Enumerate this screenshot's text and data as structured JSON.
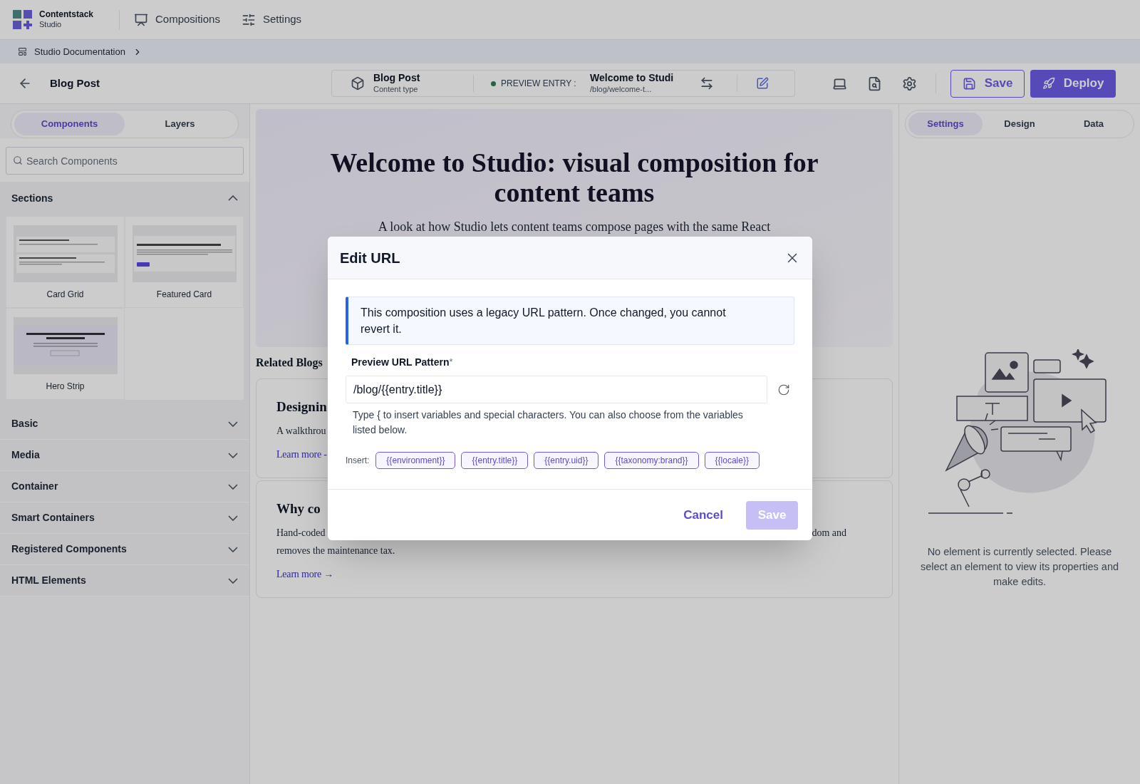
{
  "top_nav": {
    "brand": {
      "name": "Contentstack",
      "subtitle": "Studio"
    },
    "items": [
      {
        "label": "Compositions",
        "kind": "compositions"
      },
      {
        "label": "Settings",
        "kind": "settings"
      }
    ]
  },
  "breadcrumb": {
    "label": "Studio Documentation"
  },
  "toolbar": {
    "title": "Blog Post",
    "content_type": {
      "name": "Blog Post",
      "caption": "Content type"
    },
    "preview_entry": {
      "label": "PREVIEW ENTRY :",
      "title": "Welcome to Studi",
      "url": "/blog/welcome-t..."
    },
    "save": "Save",
    "deploy": "Deploy"
  },
  "left_panel": {
    "tabs": [
      {
        "label": "Components",
        "selected": true
      },
      {
        "label": "Layers",
        "selected": false
      }
    ],
    "search": {
      "placeholder": "Search Components"
    },
    "sections": [
      {
        "label": "Sections",
        "expanded": true,
        "components": [
          {
            "label": "Card Grid",
            "kind": "cards"
          },
          {
            "label": "Featured Card",
            "kind": "featured"
          },
          {
            "label": "Hero Strip",
            "kind": "hero"
          }
        ]
      },
      {
        "label": "Basic",
        "expanded": false
      },
      {
        "label": "Media",
        "expanded": false
      },
      {
        "label": "Container",
        "expanded": false
      },
      {
        "label": "Smart Containers",
        "expanded": false
      },
      {
        "label": "Registered Components",
        "expanded": false
      },
      {
        "label": "HTML Elements",
        "expanded": false
      }
    ]
  },
  "canvas": {
    "hero": {
      "title": "Welcome to Studio: visual composition for content teams",
      "subtitle": "A look at how Studio lets content teams compose pages with the same React"
    },
    "related_heading": "Related Blogs",
    "cards": [
      {
        "title": "Designin",
        "line_left": "A walkthrou",
        "link": "Learn more -"
      },
      {
        "title": "Why co",
        "line_left": "Hand-coded",
        "line_right": "dom and",
        "line_2": "removes the maintenance tax.",
        "link": "Learn more →"
      }
    ]
  },
  "right_panel": {
    "tabs": [
      {
        "label": "Settings",
        "selected": true
      },
      {
        "label": "Design",
        "selected": false
      },
      {
        "label": "Data",
        "selected": false
      }
    ],
    "empty_message": "No element is currently selected. Please select an element to view its properties and make edits."
  },
  "dialog": {
    "title": "Edit URL",
    "notice": "This composition uses a legacy URL pattern. Once changed, you cannot revert it.",
    "field": {
      "label": "Preview URL Pattern",
      "required_mark": "*",
      "value": "/blog/{{entry.title}}"
    },
    "help": "Type { to insert variables and special characters. You can also choose from the variables listed below.",
    "insert_label": "Insert:",
    "chips": [
      "{{environment}}",
      "{{entry.title}}",
      "{{entry.uid}}",
      "{{taxonomy:brand}}",
      "{{locale}}"
    ],
    "cancel": "Cancel",
    "save": {
      "label": "Save",
      "disabled": true
    }
  }
}
